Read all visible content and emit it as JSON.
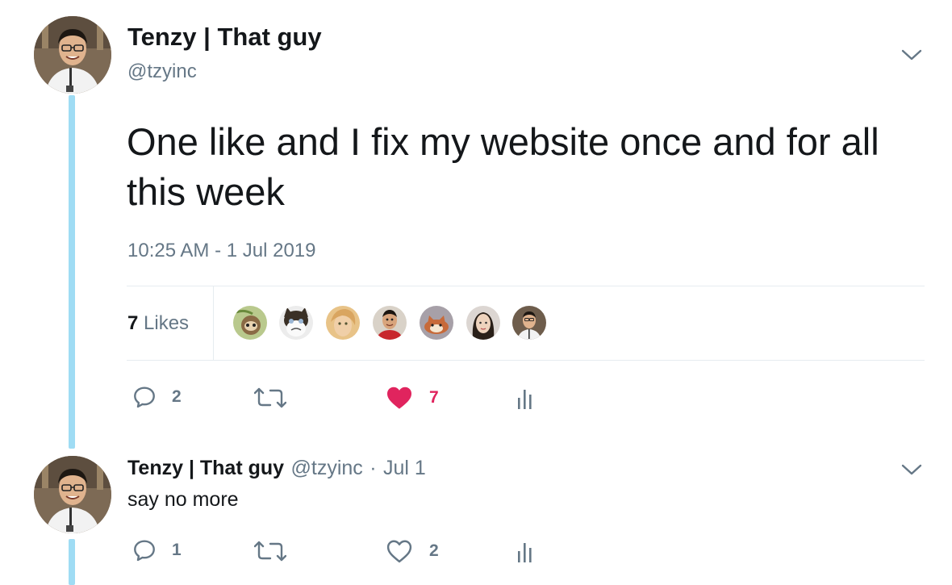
{
  "main_tweet": {
    "author_name": "Tenzy | That guy",
    "author_handle": "@tzyinc",
    "text": "One like and I fix my website once and for all this week",
    "timestamp": "10:25 AM - 1 Jul 2019",
    "likes": {
      "count": "7",
      "label": "Likes",
      "likers": [
        "sloth-avatar",
        "grumpy-cat-avatar",
        "blonde-person-avatar",
        "man-red-shirt-avatar",
        "cartoon-fox-avatar",
        "woman-avatar",
        "tenzy-avatar"
      ]
    },
    "actions": {
      "reply_count": "2",
      "retweet_count": "",
      "like_count": "7",
      "liked": true
    }
  },
  "reply_tweet": {
    "author_name": "Tenzy | That guy",
    "author_handle": "@tzyinc",
    "separator": "·",
    "date": "Jul 1",
    "text": "say no more",
    "actions": {
      "reply_count": "1",
      "retweet_count": "",
      "like_count": "2",
      "liked": false
    }
  },
  "colors": {
    "thread_line": "#9fdcf4",
    "like_red": "#e0245e",
    "secondary_text": "#657786",
    "divider": "#e6ecf0"
  },
  "icons": [
    "reply-icon",
    "retweet-icon",
    "heart-icon",
    "analytics-icon",
    "chevron-down-icon"
  ]
}
